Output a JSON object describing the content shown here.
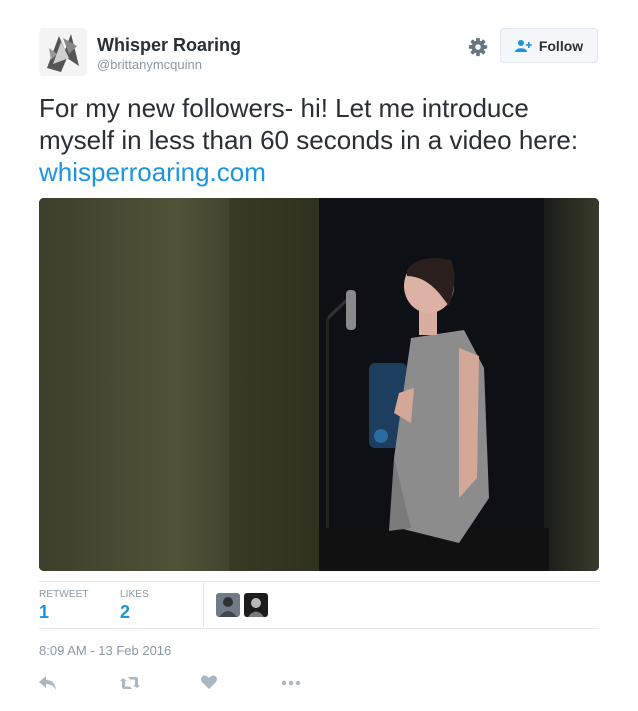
{
  "user": {
    "display_name": "Whisper Roaring",
    "handle": "@brittanymcquinn"
  },
  "header": {
    "follow_label": "Follow"
  },
  "tweet": {
    "text": "For my new followers- hi! Let me introduce myself in less than 60 seconds in a video here: ",
    "link_text": "whisperroaring.com"
  },
  "stats": {
    "retweets_label": "RETWEET",
    "retweets_count": "1",
    "likes_label": "LIKES",
    "likes_count": "2"
  },
  "timestamp": "8:09 AM - 13 Feb 2016",
  "icons": {
    "settings": "gear-icon",
    "follow": "add-user-icon",
    "reply": "reply-icon",
    "retweet": "retweet-icon",
    "like": "heart-icon",
    "more": "more-icon"
  },
  "colors": {
    "link": "#1b95e0",
    "muted": "#8899a6",
    "text": "#292f33",
    "border": "#e1e8ed"
  }
}
